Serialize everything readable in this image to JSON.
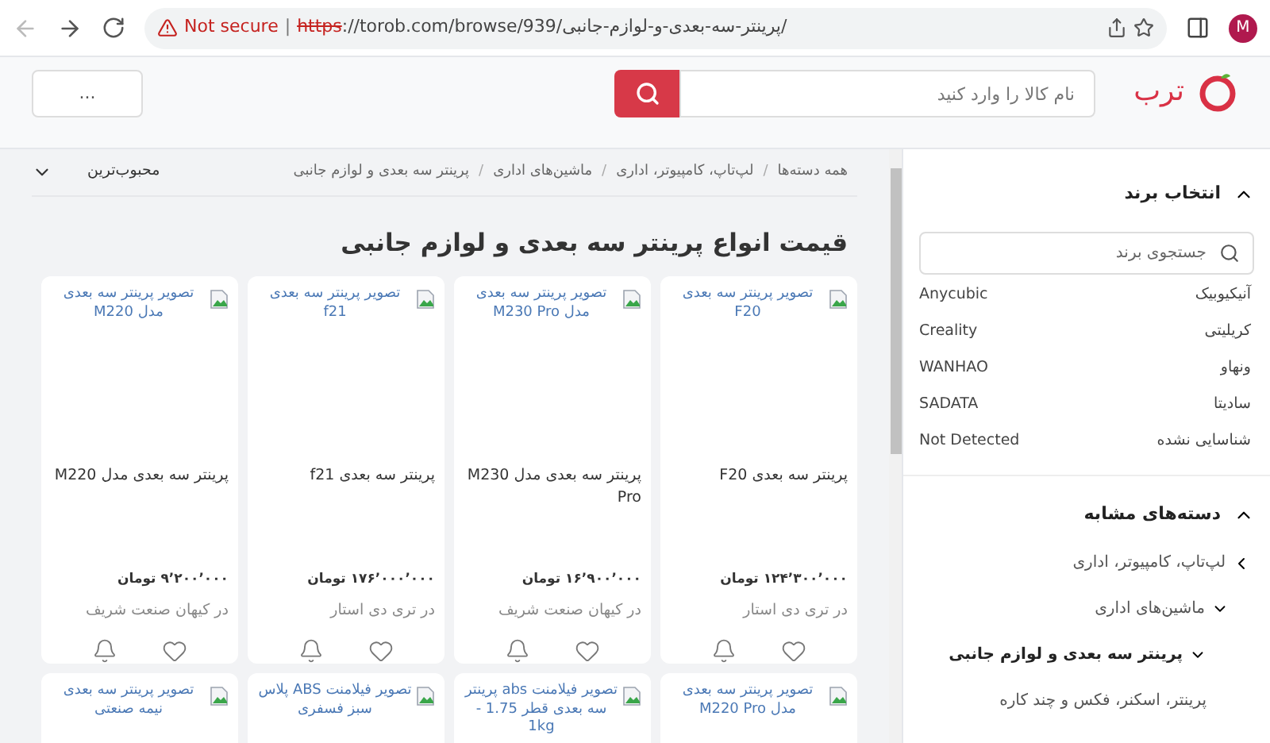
{
  "browser": {
    "security": "Not secure",
    "divider": "|",
    "scheme": "https",
    "url_rest": "://torob.com/browse/939/پرینتر-سه-بعدی-و-لوازم-جانبی/",
    "profile_initial": "M"
  },
  "header": {
    "logo_text": "ترب",
    "search": {
      "placeholder": "نام کالا را وارد کنید"
    },
    "left_box": "..."
  },
  "breadcrumb": {
    "separator": "/",
    "items": [
      "همه دسته‌ها",
      "لپ‌تاپ، کامپیوتر، اداری",
      "ماشین‌های اداری",
      "پرینتر سه بعدی و لوازم جانبی"
    ]
  },
  "sort": {
    "label": "محبوب‌ترین"
  },
  "page_title": "قیمت انواع پرینتر سه بعدی و لوازم جانبی",
  "products": [
    {
      "image_alt": "تصویر پرینتر سه بعدی F20",
      "title": "پرینتر سه بعدی F20",
      "price": "۱۲۴٬۳۰۰٬۰۰۰ تومان",
      "seller": "در تری دی استار"
    },
    {
      "image_alt": "تصویر پرینتر سه بعدی مدل M230 Pro",
      "title": "پرینتر سه بعدی مدل M230 Pro",
      "price": "۱۶٬۹۰۰٬۰۰۰ تومان",
      "seller": "در کیهان صنعت شریف"
    },
    {
      "image_alt": "تصویر پرینتر سه بعدی f21",
      "title": "پرینتر سه بعدی f21",
      "price": "۱۷۶٬۰۰۰٬۰۰۰ تومان",
      "seller": "در تری دی استار"
    },
    {
      "image_alt": "تصویر پرینتر سه بعدی مدل M220",
      "title": "پرینتر سه بعدی مدل M220",
      "price": "۹٬۲۰۰٬۰۰۰ تومان",
      "seller": "در کیهان صنعت شریف"
    },
    {
      "image_alt": "تصویر پرینتر سه بعدی مدل M220 Pro"
    },
    {
      "image_alt": "تصویر فیلامنت abs پرینتر سه بعدی قطر 1.75 - 1kg"
    },
    {
      "image_alt": "تصویر فیلامنت ABS پلاس سبز فسفری"
    },
    {
      "image_alt": "تصویر پرینتر سه بعدی نیمه صنعتی"
    }
  ],
  "brand_filter": {
    "title": "انتخاب برند",
    "expanded": true,
    "search": {
      "placeholder": "جستجوی برند"
    },
    "brands": [
      {
        "name": "آنیکیوبیک",
        "latin": "Anycubic"
      },
      {
        "name": "کریلیتی",
        "latin": "Creality"
      },
      {
        "name": "ونهاو",
        "latin": "WANHAO"
      },
      {
        "name": "سادیتا",
        "latin": "SADATA"
      },
      {
        "name": "شناسایی نشده",
        "latin": "Not Detected"
      }
    ]
  },
  "similar_categories": {
    "title": "دسته‌های مشابه",
    "expanded": true,
    "items": [
      {
        "label": "لپ‌تاپ، کامپیوتر، اداری",
        "kind": "ancestor",
        "selected": false,
        "children": [
          {
            "label": "ماشین‌های اداری",
            "kind": "open",
            "selected": false,
            "children": [
              {
                "label": "پرینتر سه بعدی و لوازم جانبی",
                "kind": "open",
                "selected": true
              },
              {
                "label": "پرینتر، اسکنر، فکس و چند کاره",
                "kind": "leaf",
                "selected": false
              }
            ]
          }
        ]
      }
    ]
  }
}
